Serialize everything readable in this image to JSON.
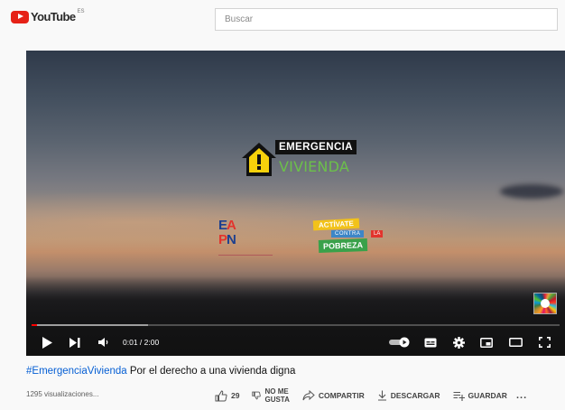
{
  "masthead": {
    "logo_text": "YouTube",
    "region": "ES",
    "search_placeholder": "Buscar"
  },
  "player": {
    "overlay": {
      "emergencia_line1": "EMERGENCIA",
      "emergencia_line2": "VIVIENDA",
      "eapn_row1": [
        "E",
        "A"
      ],
      "eapn_row2": [
        "P",
        "N"
      ],
      "activate_1": "ACTÍVATE",
      "activate_2": "CONTRA",
      "activate_3": "LA",
      "activate_4": "POBREZA"
    },
    "time": "0:01 / 2:00",
    "progress_fraction": 0.01,
    "buffered_fraction": 0.22
  },
  "video": {
    "hashtag": "#EmergenciaVivienda",
    "title_rest": " Por el derecho a una vivienda digna",
    "views": "1295 visualizaciones..."
  },
  "actions": {
    "likes": "29",
    "dislike_line1": "NO ME",
    "dislike_line2": "GUSTA",
    "share": "COMPARTIR",
    "download": "DESCARGAR",
    "save": "GUARDAR",
    "more": "..."
  },
  "colors": {
    "youtube_red": "#e62117",
    "progress_red": "#ff0000",
    "link_blue": "#065fd4"
  }
}
